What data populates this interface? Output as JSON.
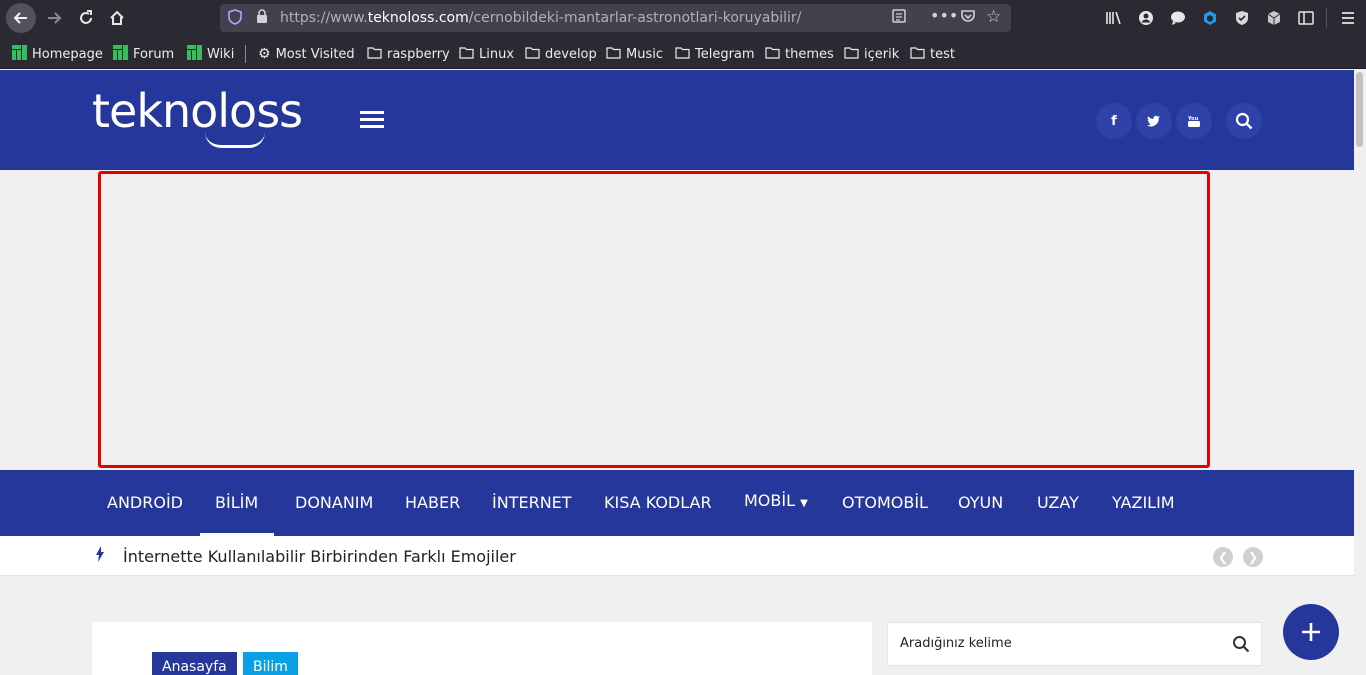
{
  "browser": {
    "url_prefix": "https://www.",
    "url_domain": "teknoloss.com",
    "url_path": "/cernobildeki-mantarlar-astronotlari-koruyabilir/",
    "bookmarks": [
      "Homepage",
      "Forum",
      "Wiki",
      "Most Visited",
      "raspberry",
      "Linux",
      "develop",
      "Music",
      "Telegram",
      "themes",
      "içerik",
      "test"
    ]
  },
  "header": {
    "logo": "teknoloss",
    "social": [
      "f",
      "t",
      "yt"
    ]
  },
  "nav": {
    "items": [
      "ANDROİD",
      "BİLİM",
      "DONANIM",
      "HABER",
      "İNTERNET",
      "KISA KODLAR",
      "MOBİL",
      "OTOMOBİL",
      "OYUN",
      "UZAY",
      "YAZILIM"
    ],
    "active": "BİLİM"
  },
  "ticker": {
    "headline": "İnternette Kullanılabilir Birbirinden Farklı Emojiler"
  },
  "breadcrumb": {
    "items": [
      "Anasayfa",
      "Bilim"
    ]
  },
  "sidebar": {
    "search_placeholder": "Aradığınız kelime"
  },
  "colors": {
    "brand": "#25379a",
    "ad_border": "#e60000",
    "crumb_category": "#0aa0e6"
  }
}
